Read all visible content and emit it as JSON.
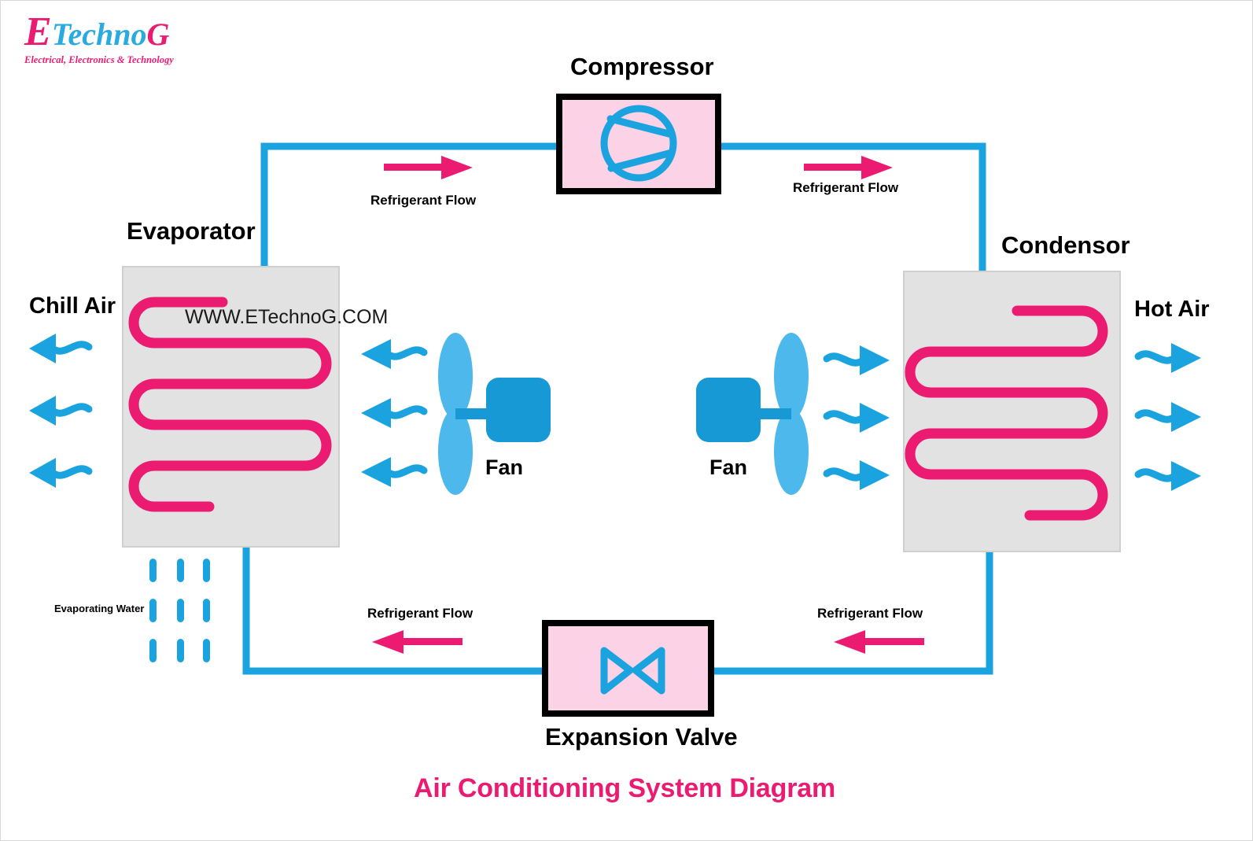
{
  "meta": {
    "title": "Air Conditioning System Diagram",
    "watermark": "WWW.ETechnoG.COM"
  },
  "logo": {
    "letter_e": "E",
    "word_techno": "Techno",
    "letter_g": "G",
    "tagline": "Electrical, Electronics & Technology"
  },
  "colors": {
    "refrigerant_pink": "#ec1b72",
    "pipe_blue": "#1ba3e0",
    "air_blue": "#1ba3e0",
    "fan_motor_blue": "#1799d6",
    "fan_blade_blue": "#4db8ec",
    "component_fill_pink": "#fcd2e6",
    "coil_box_gray": "#e2e2e2",
    "outline_black": "#000000",
    "title_pink": "#ec1b72"
  },
  "components": {
    "compressor": {
      "label": "Compressor",
      "symbol": "compressor-circle-wedge"
    },
    "evaporator": {
      "label": "Evaporator",
      "symbol": "serpentine-coil",
      "coil_passes": 5
    },
    "condenser": {
      "label": "Condensor",
      "symbol": "serpentine-coil",
      "coil_passes": 5
    },
    "expansion_valve": {
      "label": "Expansion Valve",
      "symbol": "bowtie-valve"
    },
    "fan_left": {
      "label": "Fan",
      "symbol": "fan-blades-motor"
    },
    "fan_right": {
      "label": "Fan",
      "symbol": "fan-blades-motor"
    }
  },
  "air_flows": {
    "chill_air": {
      "label": "Chill Air",
      "direction": "left",
      "arrow_count": 3
    },
    "hot_air": {
      "label": "Hot Air",
      "direction": "right",
      "arrow_count": 3
    },
    "evaporator_inner": {
      "direction": "left",
      "arrow_count": 3
    },
    "condenser_inner": {
      "direction": "right",
      "arrow_count": 3
    }
  },
  "water": {
    "label": "Evaporating Water",
    "drop_rows": 3,
    "drop_cols": 3
  },
  "refrigerant_flow_labels": [
    {
      "id": "top-left",
      "text": "Refrigerant Flow",
      "direction": "right"
    },
    {
      "id": "top-right",
      "text": "Refrigerant Flow",
      "direction": "right"
    },
    {
      "id": "bottom-left",
      "text": "Refrigerant Flow",
      "direction": "left"
    },
    {
      "id": "bottom-right",
      "text": "Refrigerant Flow",
      "direction": "left"
    }
  ]
}
